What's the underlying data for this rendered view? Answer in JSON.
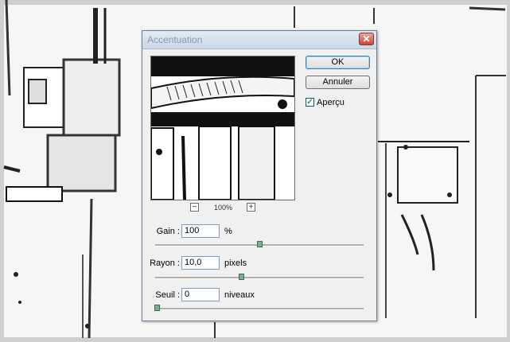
{
  "dialog": {
    "title": "Accentuation",
    "close_icon": "close-icon",
    "ok_label": "OK",
    "cancel_label": "Annuler",
    "preview_checkbox_label": "Aperçu",
    "preview_checked": true,
    "zoom_out_label": "−",
    "zoom_in_label": "+",
    "zoom_level": "100%",
    "params": {
      "gain": {
        "label": "Gain :",
        "value": "100",
        "unit": "%",
        "slider_fraction": 0.5
      },
      "rayon": {
        "label": "Rayon :",
        "value": "10,0",
        "unit": "pixels",
        "slider_fraction": 0.41
      },
      "seuil": {
        "label": "Seuil :",
        "value": "0",
        "unit": "niveaux",
        "slider_fraction": 0.0
      }
    }
  },
  "colors": {
    "close_button": "#c8473a",
    "title_text": "#8a99ac",
    "slider_thumb": "#7fae8e"
  }
}
